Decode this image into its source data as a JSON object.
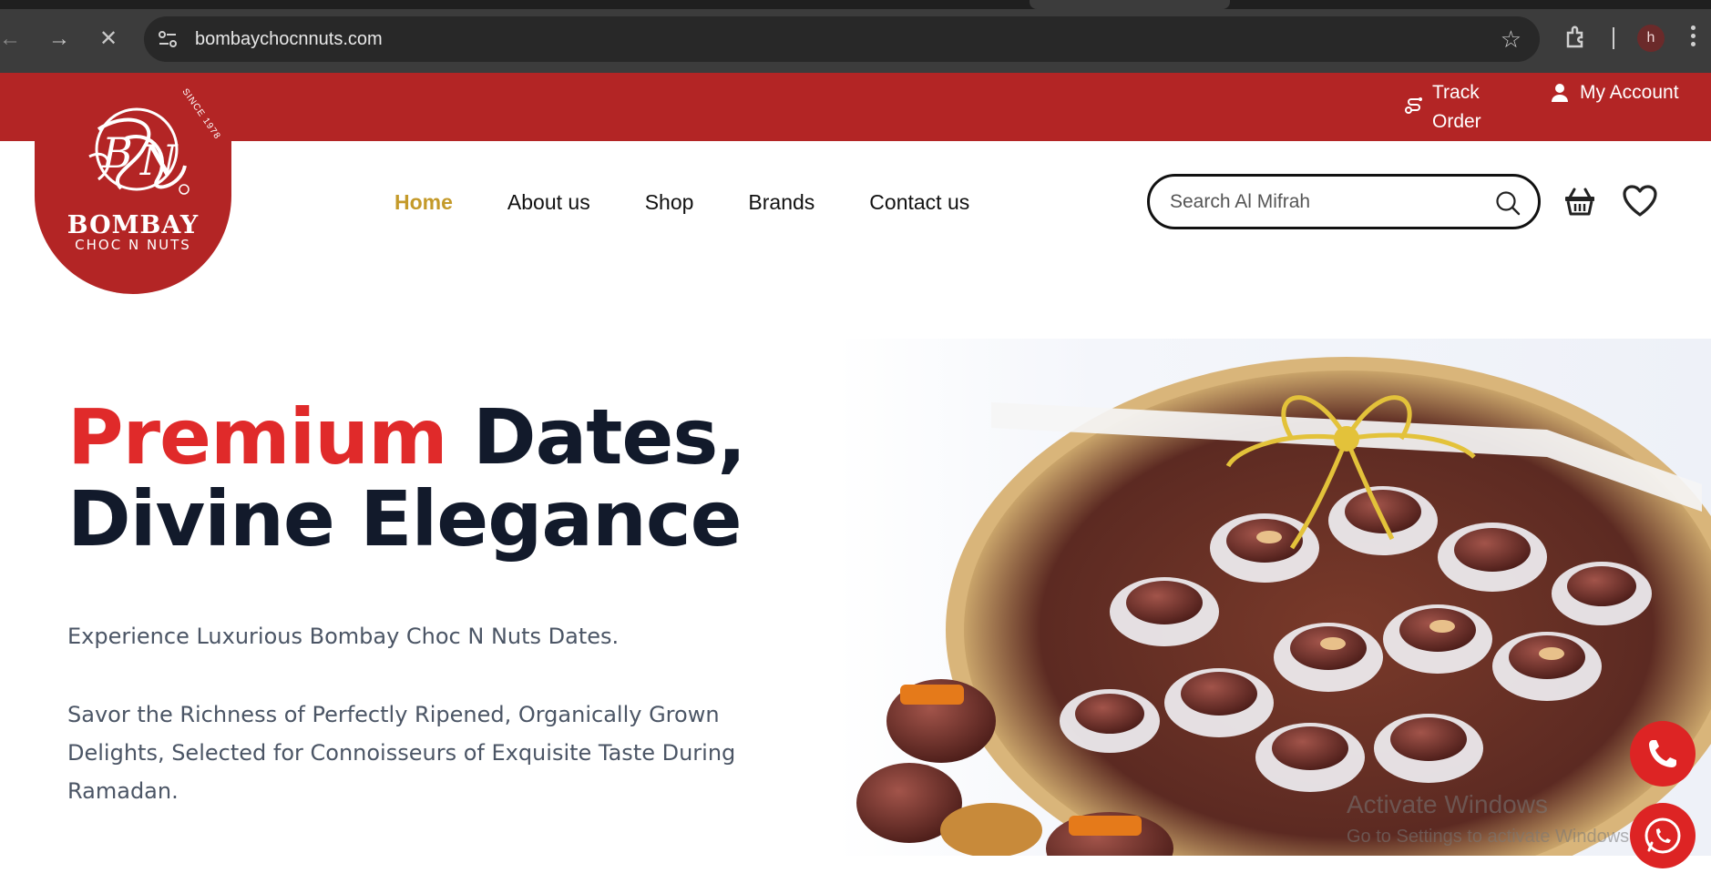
{
  "browser": {
    "url": "bombaychocnnuts.com",
    "profile_initial": "h"
  },
  "topbar": {
    "track_order": "Track Order",
    "my_account": "My Account"
  },
  "logo": {
    "since": "SINCE 1978",
    "brand": "BOMBAY",
    "sub": "CHOC N NUTS"
  },
  "nav": {
    "items": [
      {
        "label": "Home",
        "active": true
      },
      {
        "label": "About us"
      },
      {
        "label": "Shop"
      },
      {
        "label": "Brands"
      },
      {
        "label": "Contact us"
      }
    ]
  },
  "search": {
    "placeholder": "Search Al Mifrah"
  },
  "hero": {
    "title_accent": "Premium",
    "title_rest": " Dates,",
    "title_line2": "Divine Elegance",
    "para1": "Experience Luxurious Bombay Choc N Nuts Dates.",
    "para2": "Savor the Richness of Perfectly Ripened, Organically Grown Delights, Selected for Connoisseurs of Exquisite Taste During Ramadan."
  },
  "watermark": {
    "line1": "Activate Windows",
    "line2": "Go to Settings to activate Windows."
  },
  "colors": {
    "brand_red": "#b32525",
    "accent_red": "#e02a2a",
    "nav_active": "#c49a2a",
    "heading_dark": "#121a2b"
  }
}
